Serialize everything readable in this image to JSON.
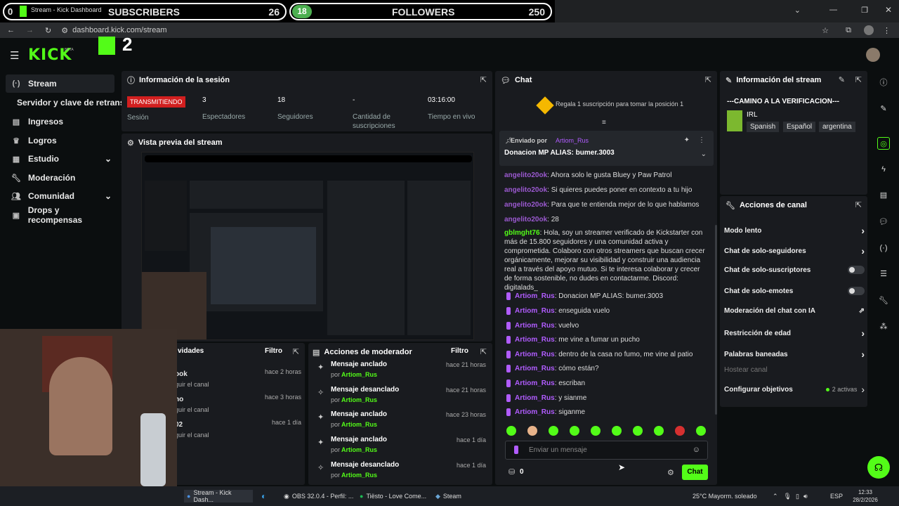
{
  "overlay": {
    "subs_index": "0",
    "subscribers_label": "SUBSCRIBERS",
    "subscribers_count": "26",
    "followers_index": "18",
    "followers_label": "FOLLOWERS",
    "followers_count": "250",
    "stream_number": "2"
  },
  "browser": {
    "tab_title": "Stream - Kick Dashboard",
    "url": "dashboard.kick.com/stream"
  },
  "brand": {
    "logo": "KICK",
    "beta": "BETA",
    "accent": "#53fc18"
  },
  "sidebar": {
    "items": [
      {
        "label": "Stream",
        "icon": "broadcast-icon"
      },
      {
        "label": "Servidor y clave de retransm",
        "icon": ""
      },
      {
        "label": "Ingresos",
        "icon": "chart-icon"
      },
      {
        "label": "Logros",
        "icon": "trophy-icon"
      },
      {
        "label": "Estudio",
        "icon": "studio-icon"
      },
      {
        "label": "Moderación",
        "icon": "wrench-icon"
      },
      {
        "label": "Comunidad",
        "icon": "people-icon"
      },
      {
        "label": "Drops y recompensas",
        "icon": "gift-icon"
      }
    ]
  },
  "session": {
    "title": "Información de la sesión",
    "badge": "TRANSMITIENDO",
    "badge_label": "Sesión",
    "stats": [
      {
        "value": "3",
        "label": "Espectadores"
      },
      {
        "value": "18",
        "label": "Seguidores"
      },
      {
        "value": "-",
        "label": "Cantidad de suscripciones"
      },
      {
        "value": "03:16:00",
        "label": "Tiempo en vivo"
      }
    ]
  },
  "preview": {
    "title": "Vista previa del stream"
  },
  "activity": {
    "title": "vidades",
    "filter": "Filtro",
    "rows": [
      {
        "name": "ook",
        "action": "guir el canal",
        "time": "hace 2 horas"
      },
      {
        "name": "no",
        "action": "guir el canal",
        "time": "hace 3 horas"
      },
      {
        "name": "02",
        "action": "guir el canal",
        "time": "hace 1 día"
      }
    ]
  },
  "mod_actions": {
    "title": "Acciones de moderador",
    "filter": "Filtro",
    "by": "por",
    "rows": [
      {
        "action": "Mensaje anclado",
        "user": "Artiom_Rus",
        "time": "hace 21 horas",
        "icon": "pin-icon"
      },
      {
        "action": "Mensaje desanclado",
        "user": "Artiom_Rus",
        "time": "hace 21 horas",
        "icon": "unpin-icon"
      },
      {
        "action": "Mensaje anclado",
        "user": "Artiom_Rus",
        "time": "hace 23 horas",
        "icon": "pin-icon"
      },
      {
        "action": "Mensaje anclado",
        "user": "Artiom_Rus",
        "time": "hace 1 día",
        "icon": "pin-icon"
      },
      {
        "action": "Mensaje desanclado",
        "user": "Artiom_Rus",
        "time": "hace 1 día",
        "icon": "unpin-icon"
      }
    ]
  },
  "chat": {
    "title": "Chat",
    "gift_text": "Regala 1 suscripción para tomar la posición 1",
    "pinned_by": "Enviado por",
    "pinned_user": "Artiom_Rus",
    "pinned_message": "Donacion MP ALIAS: bumer.3003",
    "messages": [
      {
        "user": "angelito20ok",
        "text": ": Ahora solo le gusta Bluey y Paw Patrol",
        "color": "#9b59d0"
      },
      {
        "user": "angelito20ok",
        "text": ": Si quieres puedes poner en contexto a tu hijo",
        "color": "#9b59d0"
      },
      {
        "user": "angelito20ok",
        "text": ": Para que te entienda mejor de lo que hablamos",
        "color": "#9b59d0"
      },
      {
        "user": "angelito20ok",
        "text": ": 28",
        "color": "#9b59d0"
      },
      {
        "user": "gblmght76",
        "text": ": Hola, soy un streamer verificado de Kickstarter con más de 15.800 seguidores y una comunidad activa y comprometida. Colaboro con otros streamers que buscan crecer orgánicamente, mejorar su visibilidad y construir una audiencia real a través del apoyo mutuo. Si te interesa colaborar y crecer de forma sostenible, no dudes en contactarme. Discord: digitalads_",
        "color": "#53fc18"
      },
      {
        "user": "Artiom_Rus",
        "text": ": Donacion MP ALIAS: bumer.3003",
        "color": "#b15cff"
      },
      {
        "user": "Artiom_Rus",
        "text": ": enseguida vuelo",
        "color": "#b15cff"
      },
      {
        "user": "Artiom_Rus",
        "text": ": vuelvo",
        "color": "#b15cff"
      },
      {
        "user": "Artiom_Rus",
        "text": ": me vine a fumar un pucho",
        "color": "#b15cff"
      },
      {
        "user": "Artiom_Rus",
        "text": ": dentro de la casa no fumo, me vine al patio",
        "color": "#b15cff"
      },
      {
        "user": "Artiom_Rus",
        "text": ": cómo están?",
        "color": "#b15cff"
      },
      {
        "user": "Artiom_Rus",
        "text": ": escriban",
        "color": "#b15cff"
      },
      {
        "user": "Artiom_Rus",
        "text": ": y sianme",
        "color": "#b15cff"
      },
      {
        "user": "Artiom_Rus",
        "text": ": siganme",
        "color": "#b15cff"
      }
    ],
    "input_placeholder": "Enviar un mensaje",
    "points": "0",
    "send_label": "Chat"
  },
  "stream_info": {
    "title": "Información del stream",
    "stream_title": "---CAMINO A LA VERIFICACION---",
    "category": "IRL",
    "tags": [
      "Spanish",
      "Español",
      "argentina"
    ]
  },
  "channel_actions": {
    "title": "Acciones de canal",
    "rows": [
      {
        "label": "Modo lento",
        "control": "chevron"
      },
      {
        "label": "Chat de solo-seguidores",
        "control": "chevron"
      },
      {
        "label": "Chat de solo-suscriptores",
        "control": "toggle"
      },
      {
        "label": "Chat de solo-emotes",
        "control": "toggle"
      },
      {
        "label": "Moderación del chat con IA",
        "control": "external"
      },
      {
        "label": "Restricción de edad",
        "control": "chevron"
      },
      {
        "label": "Palabras baneadas",
        "control": "chevron"
      },
      {
        "label": "Hostear canal",
        "control": "none"
      },
      {
        "label": "Configurar objetivos",
        "control": "chevron"
      }
    ],
    "goals_badge": "2 activas"
  },
  "taskbar": {
    "items": [
      "Stream - Kick Dash...",
      "OBS 32.0.4 - Perfil: ...",
      "Tiësto - Love Come...",
      "Steam"
    ],
    "weather": "25°C  Mayorm. soleado",
    "lang": "ESP",
    "time": "12:33",
    "date": "28/2/2026"
  }
}
